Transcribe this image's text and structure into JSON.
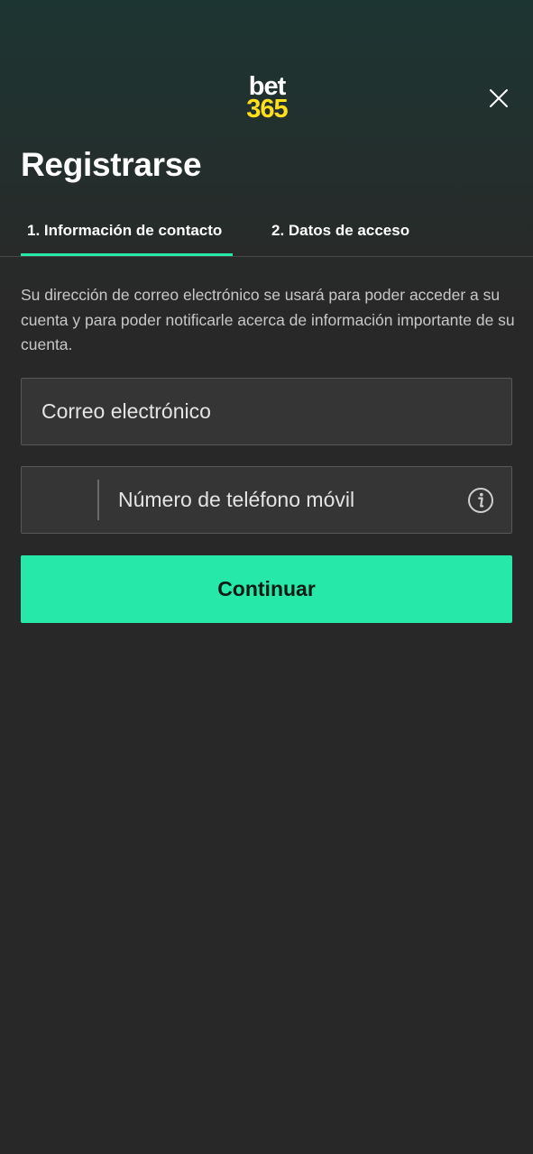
{
  "header": {
    "logo_top": "bet",
    "logo_bottom": "365",
    "close_icon": "close-icon",
    "title": "Registrarse"
  },
  "tabs": [
    {
      "label": "1.  Información de contacto",
      "active": true
    },
    {
      "label": "2.  Datos de acceso",
      "active": false
    }
  ],
  "form": {
    "description": "Su dirección de correo electrónico se usará para poder acceder a su cuenta y para poder notificarle acerca de información importante de su cuenta.",
    "email": {
      "value": "",
      "placeholder": "Correo electrónico"
    },
    "phone": {
      "value": "",
      "placeholder": "Número de teléfono móvil",
      "country_code": "",
      "info_icon": "info-icon"
    },
    "continue_label": "Continuar"
  },
  "colors": {
    "accent": "#26e8a8",
    "logo_yellow": "#ffdf1b",
    "background": "#282828",
    "field_background": "#353535"
  }
}
